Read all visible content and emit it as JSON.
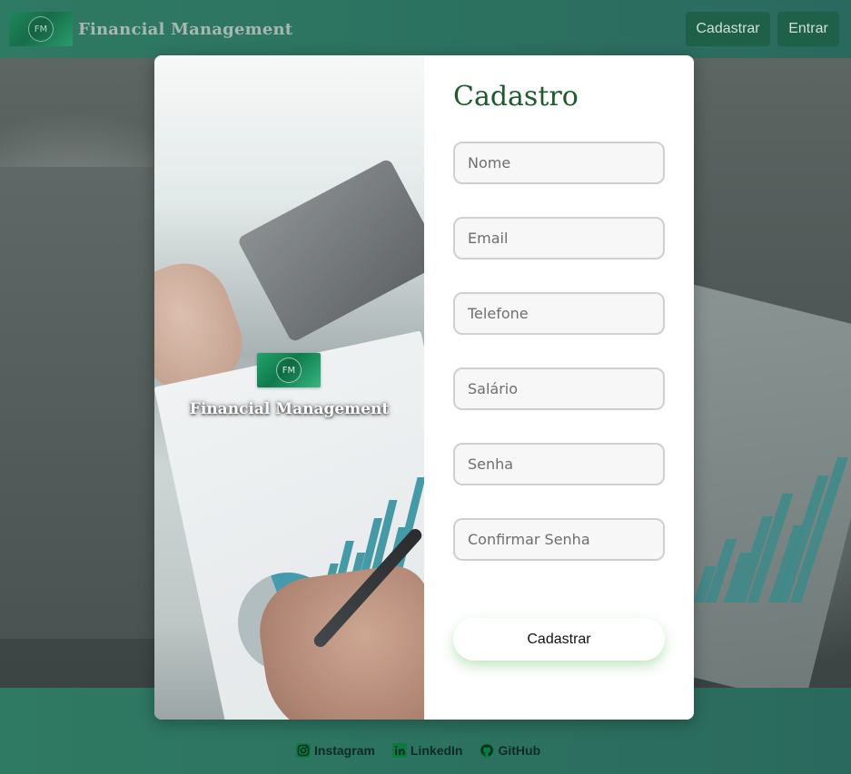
{
  "header": {
    "brand_title": "Financial Management",
    "logo_text": "FM",
    "nav_cadastrar": "Cadastrar",
    "nav_entrar": "Entrar"
  },
  "modal": {
    "brand_title": "Financial Management",
    "logo_text": "FM",
    "form": {
      "title": "Cadastro",
      "fields": {
        "nome": {
          "placeholder": "Nome",
          "value": ""
        },
        "email": {
          "placeholder": "Email",
          "value": ""
        },
        "telefone": {
          "placeholder": "Telefone",
          "value": ""
        },
        "salario": {
          "placeholder": "Salário",
          "value": ""
        },
        "senha": {
          "placeholder": "Senha",
          "value": ""
        },
        "confirmar_senha": {
          "placeholder": "Confirmar Senha",
          "value": ""
        }
      },
      "submit_label": "Cadastrar"
    }
  },
  "footer": {
    "links": [
      {
        "label": "Instagram",
        "icon": "instagram-icon"
      },
      {
        "label": "LinkedIn",
        "icon": "linkedin-icon"
      },
      {
        "label": "GitHub",
        "icon": "github-icon"
      }
    ]
  },
  "colors": {
    "brand_green": "#2f7a63",
    "nav_button": "#1f6048",
    "title_green": "#1e5a2e"
  }
}
